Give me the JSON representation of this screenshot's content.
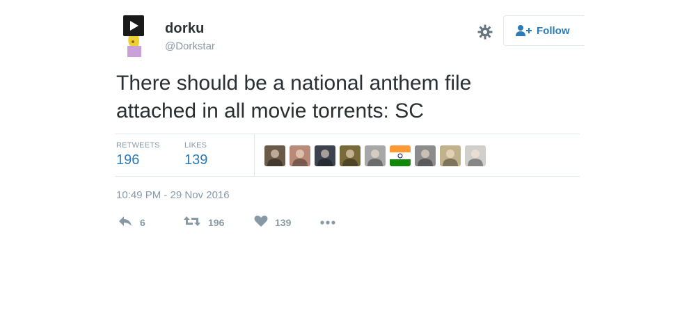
{
  "user": {
    "name": "dorku",
    "handle": "@Dorkstar"
  },
  "follow": {
    "label": "Follow"
  },
  "tweet": {
    "lines": [
      "There should be a national anthem file",
      "attached in all movie torrents: SC"
    ],
    "timestamp": "10:49 PM - 29 Nov 2016"
  },
  "stats": {
    "retweets_label": "RETWEETS",
    "retweets_count": "196",
    "likes_label": "LIKES",
    "likes_count": "139"
  },
  "likers": [
    {
      "icon": "liker-avatar-1",
      "color": "#6b5a48"
    },
    {
      "icon": "liker-avatar-2",
      "color": "#b98a78"
    },
    {
      "icon": "liker-avatar-3",
      "color": "#3c4250"
    },
    {
      "icon": "liker-avatar-4",
      "color": "#7a6a3a"
    },
    {
      "icon": "liker-avatar-5",
      "color": "#a7a7a7"
    },
    {
      "icon": "liker-avatar-flag",
      "color": "#ff9933"
    },
    {
      "icon": "liker-avatar-7",
      "color": "#8c8c8c"
    },
    {
      "icon": "liker-avatar-8",
      "color": "#c2b28c"
    },
    {
      "icon": "liker-avatar-9",
      "color": "#d0cfcc"
    }
  ],
  "actions": {
    "reply_count": "6",
    "retweet_count": "196",
    "like_count": "139"
  },
  "colors": {
    "accent": "#2b7bb9",
    "muted": "#8899a6",
    "text": "#292f33",
    "border": "#e1e8ed"
  }
}
